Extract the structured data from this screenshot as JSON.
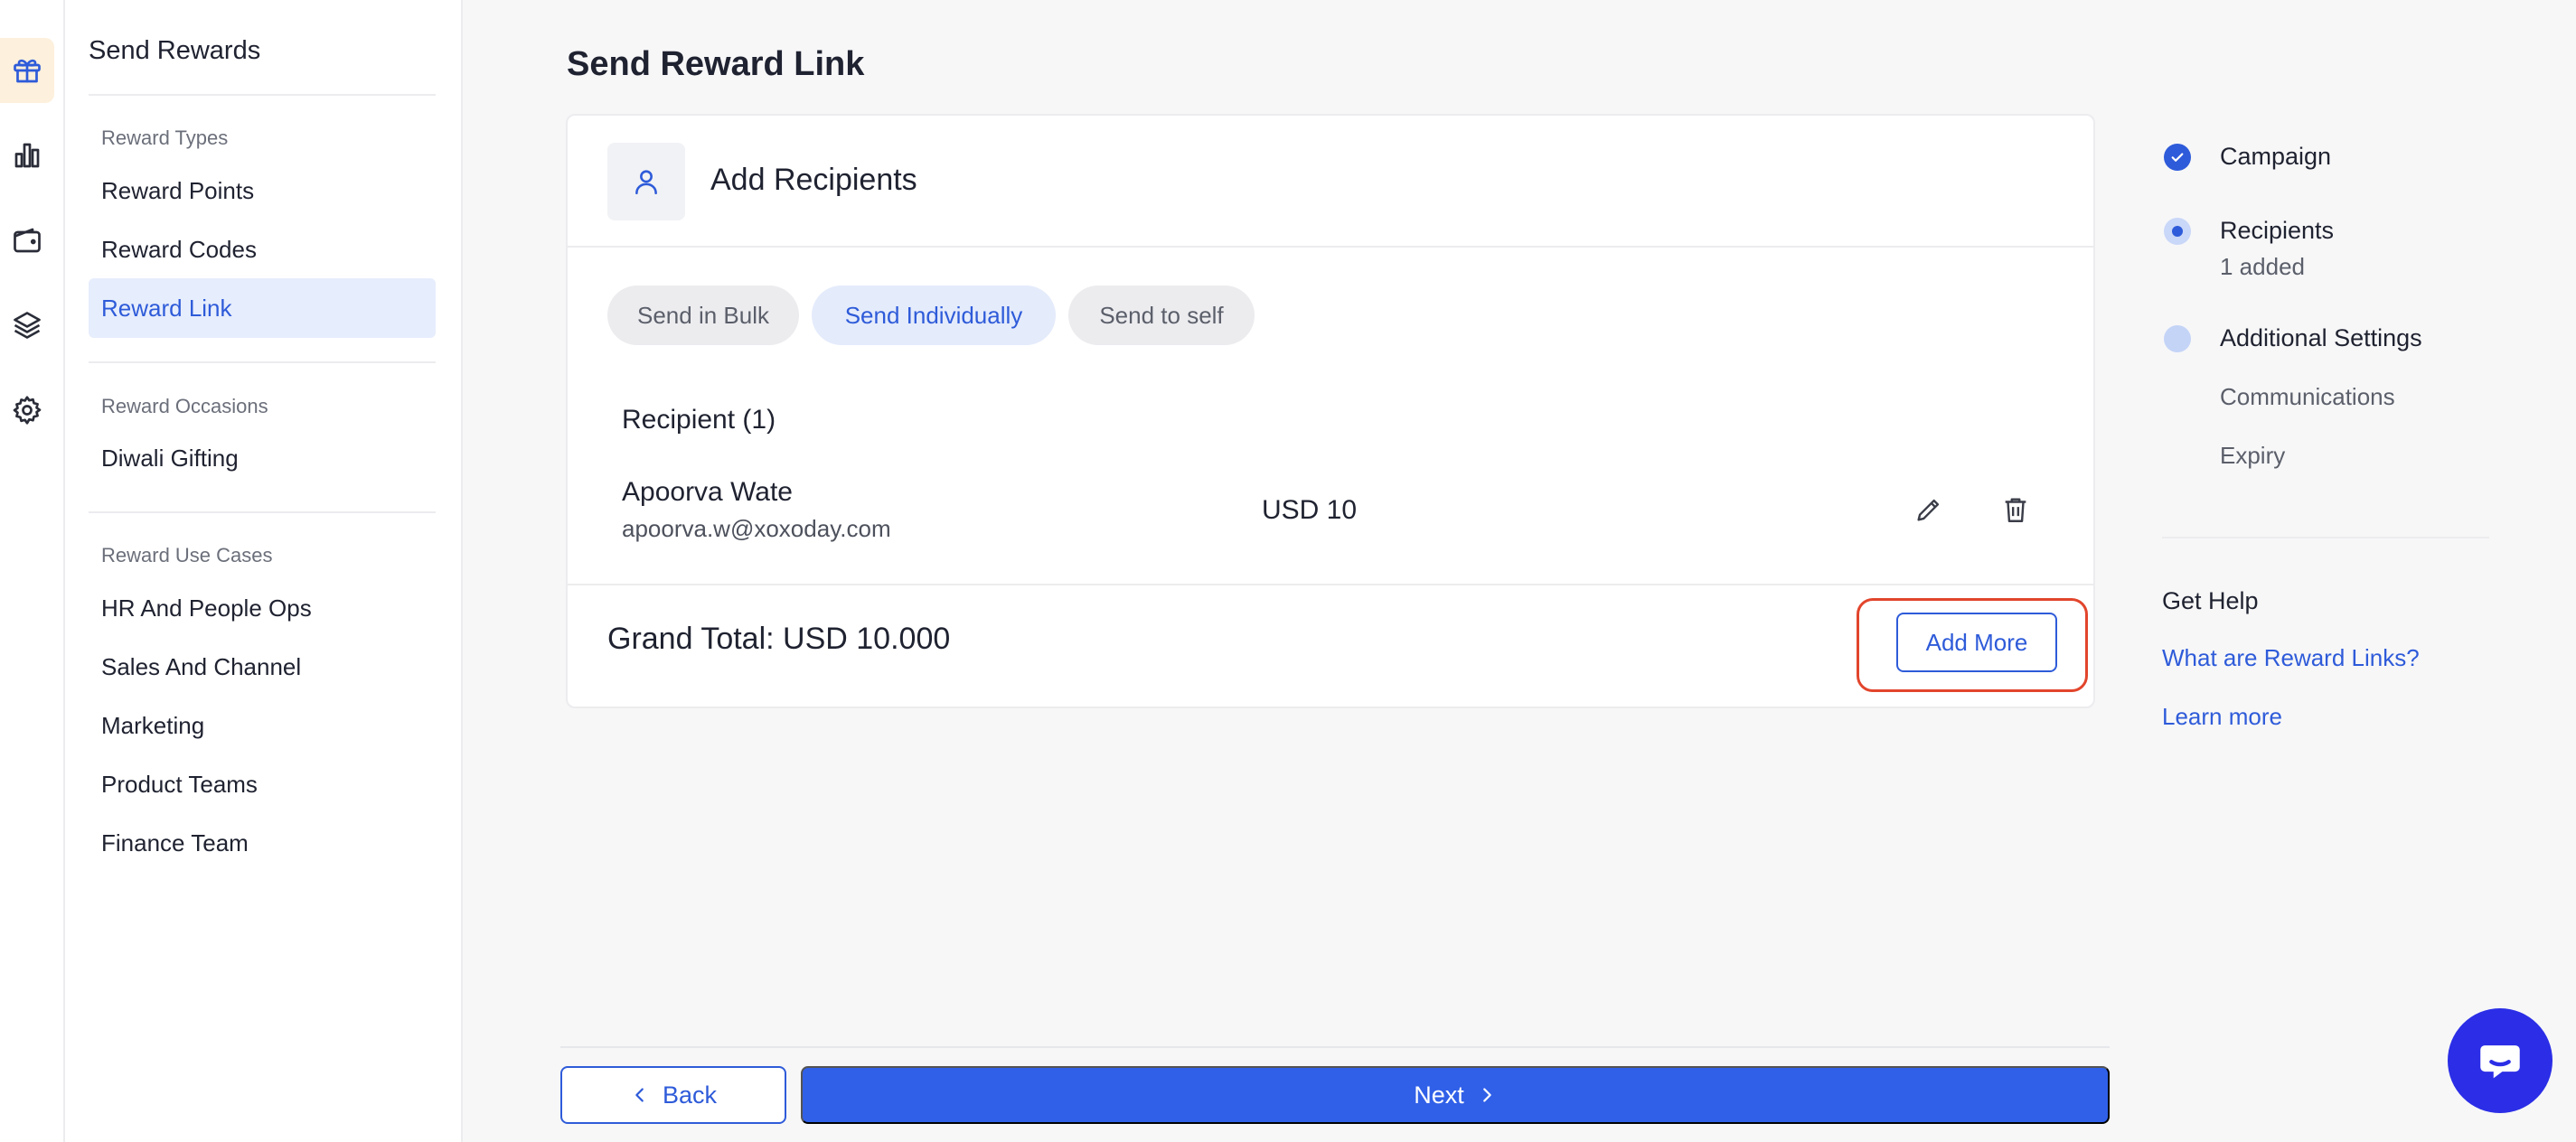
{
  "rail": {
    "items": [
      {
        "icon": "gift-icon",
        "active": true
      },
      {
        "icon": "bar-chart-icon",
        "active": false
      },
      {
        "icon": "wallet-icon",
        "active": false
      },
      {
        "icon": "layers-icon",
        "active": false
      },
      {
        "icon": "gear-icon",
        "active": false
      }
    ]
  },
  "sidebar": {
    "title": "Send Rewards",
    "sections": [
      {
        "heading": "Reward Types",
        "items": [
          "Reward Points",
          "Reward Codes",
          "Reward Link"
        ],
        "active": "Reward Link"
      },
      {
        "heading": "Reward Occasions",
        "items": [
          "Diwali Gifting"
        ]
      },
      {
        "heading": "Reward Use Cases",
        "items": [
          "HR And People Ops",
          "Sales And Channel",
          "Marketing",
          "Product Teams",
          "Finance Team"
        ]
      }
    ]
  },
  "main": {
    "page_title": "Send Reward Link",
    "card": {
      "title": "Add Recipients",
      "tabs": [
        "Send in Bulk",
        "Send Individually",
        "Send to self"
      ],
      "active_tab": "Send Individually",
      "recipient_heading": "Recipient (1)",
      "recipient": {
        "name": "Apoorva Wate",
        "email": "apoorva.w@xoxoday.com",
        "amount": "USD 10"
      },
      "grand_total": "Grand Total: USD 10.000",
      "add_more_label": "Add More"
    }
  },
  "stepper": {
    "steps": [
      {
        "label": "Campaign",
        "status": "done"
      },
      {
        "label": "Recipients",
        "sub": "1 added",
        "status": "current"
      },
      {
        "label": "Additional Settings",
        "status": "todo",
        "children": [
          "Communications",
          "Expiry"
        ]
      }
    ]
  },
  "help": {
    "title": "Get Help",
    "links": [
      "What are Reward Links?",
      "Learn more"
    ]
  },
  "footer": {
    "back_label": "Back",
    "next_label": "Next"
  },
  "colors": {
    "accent": "#2e5bd9",
    "primary_button": "#3060e8",
    "highlight": "#e2452c",
    "chat": "#2b2ee6"
  }
}
